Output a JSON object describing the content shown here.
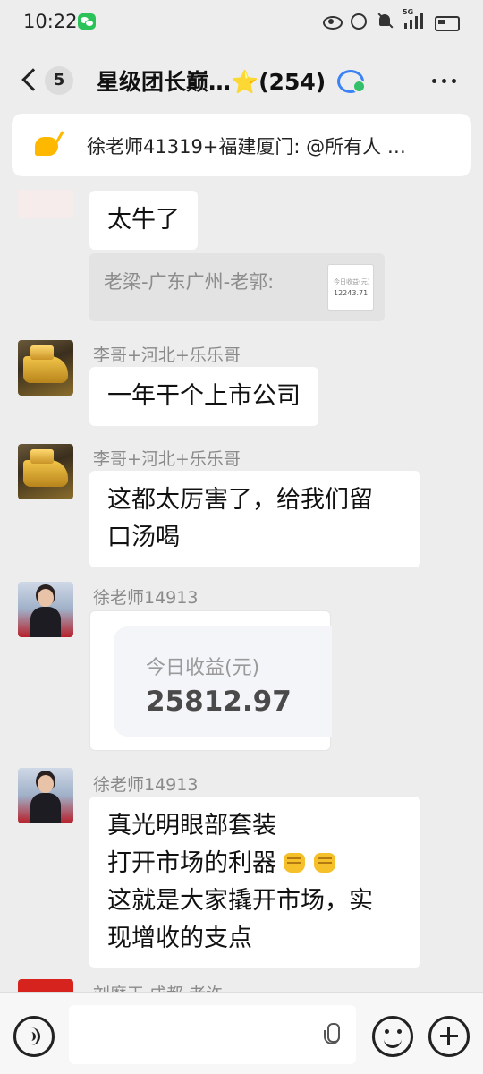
{
  "status_bar": {
    "time": "10:22",
    "network": "5G"
  },
  "header": {
    "unread_count": "5",
    "title": "星级团长巅…⭐(254)"
  },
  "pinned_notice": {
    "text": "徐老师41319+福建厦门: @所有人 …"
  },
  "messages": {
    "m0": {
      "text": "太牛了"
    },
    "quote": {
      "text": "老梁-广东广州-老郭:",
      "thumb_title": "今日收益(元)",
      "thumb_value": "12243.71"
    },
    "m1": {
      "sender": "李哥+河北+乐乐哥",
      "text": "一年干个上市公司"
    },
    "m2": {
      "sender": "李哥+河北+乐乐哥",
      "line1": "这都太厉害了，给我们留",
      "line2": "口汤喝"
    },
    "m3": {
      "sender": "徐老师14913",
      "card_label": "今日收益(元)",
      "card_value": "25812.97"
    },
    "m4": {
      "sender": "徐老师14913",
      "line1": "真光明眼部套装",
      "line2": "打开市场的利器",
      "line3": "这就是大家撬开市场，实",
      "line4": "现增收的支点"
    },
    "m5": {
      "sender": "刘麽王 成都 老许"
    }
  },
  "input_bar": {
    "placeholder": ""
  },
  "colors": {
    "background": "#ededed",
    "bubble": "#ffffff",
    "sender": "#8a8a8a",
    "accent_green": "#2bc25a"
  }
}
